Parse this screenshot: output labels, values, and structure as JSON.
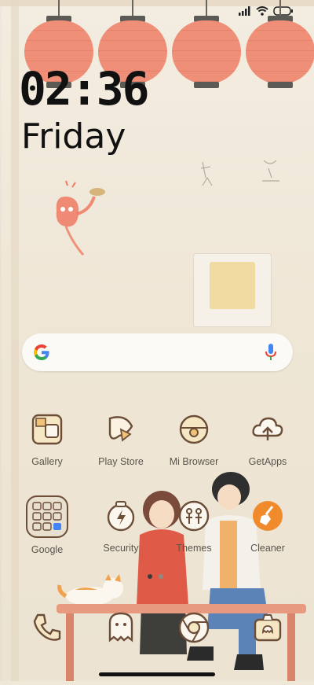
{
  "status": {
    "signal_icon": "signal-icon",
    "wifi_icon": "wifi-icon",
    "battery_icon": "battery-icon"
  },
  "clock": {
    "time": "02:36",
    "day": "Friday"
  },
  "search": {
    "google_icon": "google-g-icon",
    "mic_icon": "mic-icon"
  },
  "apps": [
    {
      "label": "Gallery",
      "icon": "gallery-icon"
    },
    {
      "label": "Play Store",
      "icon": "play-store-icon"
    },
    {
      "label": "Mi Browser",
      "icon": "browser-icon"
    },
    {
      "label": "GetApps",
      "icon": "cloud-download-icon"
    },
    {
      "label": "Google",
      "icon": "google-folder-icon"
    },
    {
      "label": "Security",
      "icon": "security-icon"
    },
    {
      "label": "Themes",
      "icon": "themes-icon"
    },
    {
      "label": "Cleaner",
      "icon": "cleaner-icon"
    }
  ],
  "dock": [
    {
      "icon": "phone-icon"
    },
    {
      "icon": "messaging-icon"
    },
    {
      "icon": "chrome-icon"
    },
    {
      "icon": "camera-icon"
    }
  ],
  "pager": {
    "pages": 2,
    "current": 1
  },
  "colors": {
    "lantern": "#ef8f78",
    "cleaner_accent": "#f08a2a",
    "text": "#111111",
    "label": "#5a544c"
  }
}
